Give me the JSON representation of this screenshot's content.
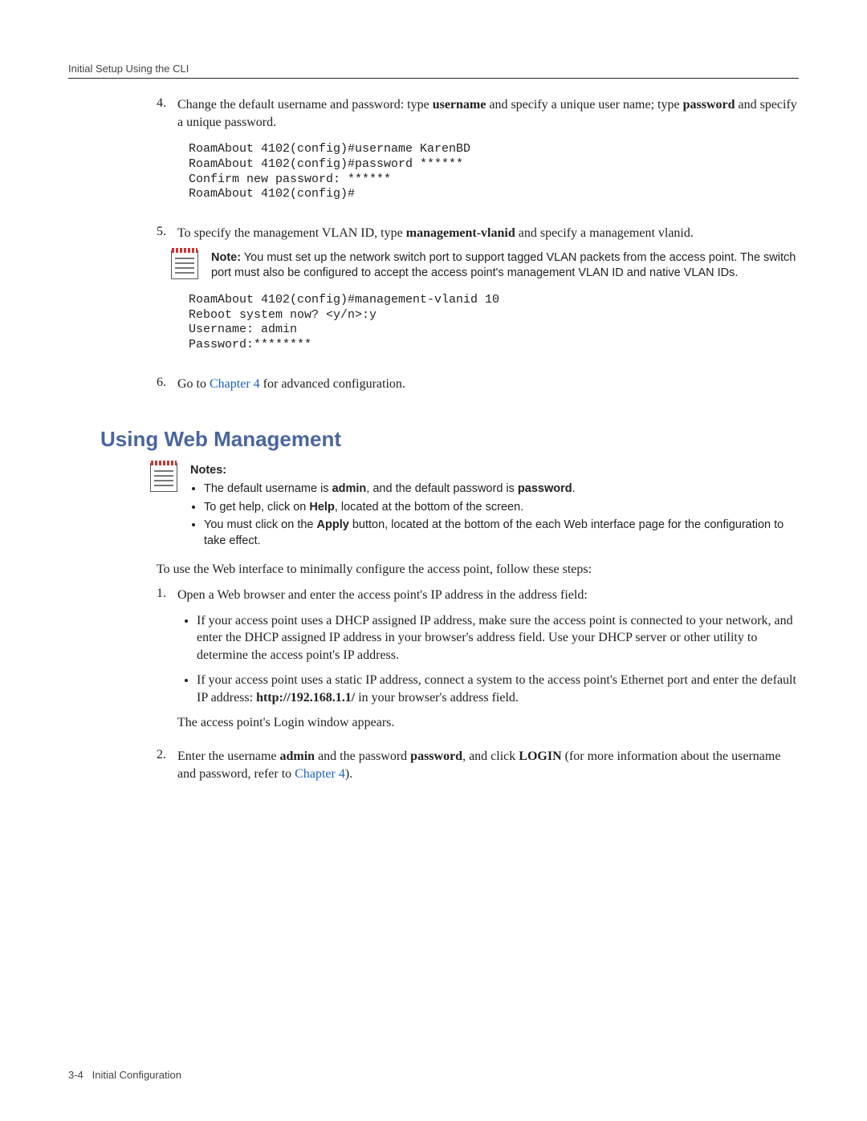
{
  "runningHeader": "Initial Setup Using the CLI",
  "step4": {
    "num": "4.",
    "pre": "Change the default username and password: type ",
    "kw1": "username",
    "mid1": " and specify a unique user name; type ",
    "kw2": "password",
    "post": " and specify a unique password."
  },
  "code1": "RoamAbout 4102(config)#username KarenBD\nRoamAbout 4102(config)#password ******\nConfirm new password: ******\nRoamAbout 4102(config)#",
  "step5": {
    "num": "5.",
    "pre": "To specify the management VLAN ID, type ",
    "kw": "management-vlanid",
    "post": " and specify a management vlanid."
  },
  "note1": {
    "label": "Note:",
    "text": " You must set up the network switch port to support tagged VLAN packets from the access point. The switch port must also be configured to accept the access point's management VLAN ID and native VLAN IDs."
  },
  "code2": "RoamAbout 4102(config)#management-vlanid 10\nReboot system now? <y/n>:y\nUsername: admin\nPassword:********",
  "step6": {
    "num": "6.",
    "pre": "Go to ",
    "link": "Chapter 4",
    "post": " for advanced configuration."
  },
  "heading2": "Using Web Management",
  "notes2": {
    "label": "Notes:",
    "b1a": "The default username is ",
    "b1kw1": "admin",
    "b1b": ", and the default password is ",
    "b1kw2": "password",
    "b1c": ".",
    "b2a": "To get help, click on ",
    "b2kw": "Help",
    "b2b": ", located at the bottom of the screen.",
    "b3a": "You must click on the ",
    "b3kw": "Apply",
    "b3b": " button, located at the bottom of the each Web interface page for the configuration to take effect."
  },
  "para1": "To use the Web interface to minimally configure the access point, follow these steps:",
  "wstep1": {
    "num": "1.",
    "text": "Open a Web browser and enter the access point's IP address in the address field:",
    "bullet1": "If your access point uses a DHCP assigned IP address, make sure the access point is connected to your network, and enter the DHCP assigned IP address in your browser's address field. Use your DHCP server or other utility to determine the access point's IP address.",
    "b2a": "If your access point uses a static IP address, connect a system to the access point's Ethernet port and enter the default IP address: ",
    "b2kw": "http://192.168.1.1/",
    "b2b": " in your browser's address field.",
    "tail": "The access point's Login window appears."
  },
  "wstep2": {
    "num": "2.",
    "a": "Enter the username ",
    "kw1": "admin",
    "b": " and the password ",
    "kw2": "password",
    "c": ", and click ",
    "kw3": "LOGIN",
    "d": " (for more information about the username and password, refer to ",
    "link": "Chapter 4",
    "e": ")."
  },
  "footer": {
    "pagenum": "3-4",
    "section": "Initial Configuration"
  }
}
